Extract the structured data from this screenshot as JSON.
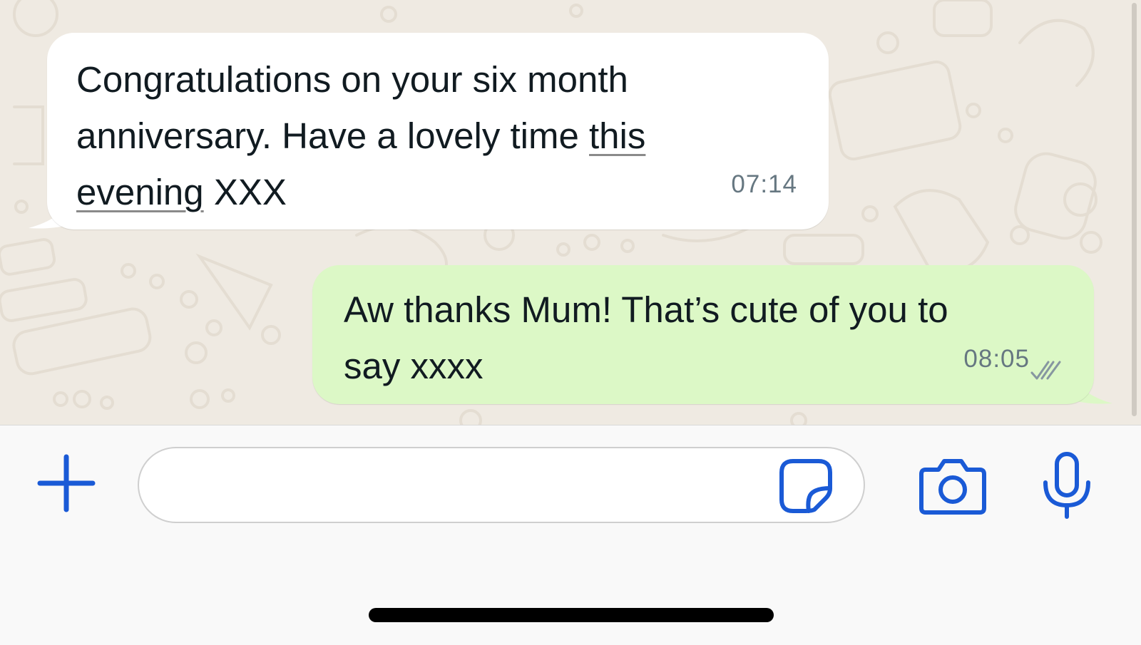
{
  "conversation": {
    "messages": [
      {
        "direction": "incoming",
        "lines": [
          [
            "Congratulations on your six month"
          ],
          [
            "anniversary. Have a lovely time ",
            "this"
          ],
          [
            "evening",
            " XXX"
          ]
        ],
        "time": "07:14"
      },
      {
        "direction": "outgoing",
        "lines": [
          [
            "Aw thanks Mum! That’s cute of you to"
          ],
          [
            "say xxxx"
          ]
        ],
        "time": "08:05",
        "status_icon": "double-check-icon"
      }
    ]
  },
  "input_bar": {
    "message_input": {
      "value": "",
      "placeholder": ""
    },
    "icons": [
      "plus-icon",
      "sticker-icon",
      "camera-icon",
      "microphone-icon"
    ]
  },
  "colors": {
    "accent": "#1a5ad6",
    "incoming_bubble": "#ffffff",
    "outgoing_bubble": "#dcf8c6",
    "chat_background": "#efeae2",
    "timestamp": "#667781",
    "read_ticks": "#8696a0"
  }
}
